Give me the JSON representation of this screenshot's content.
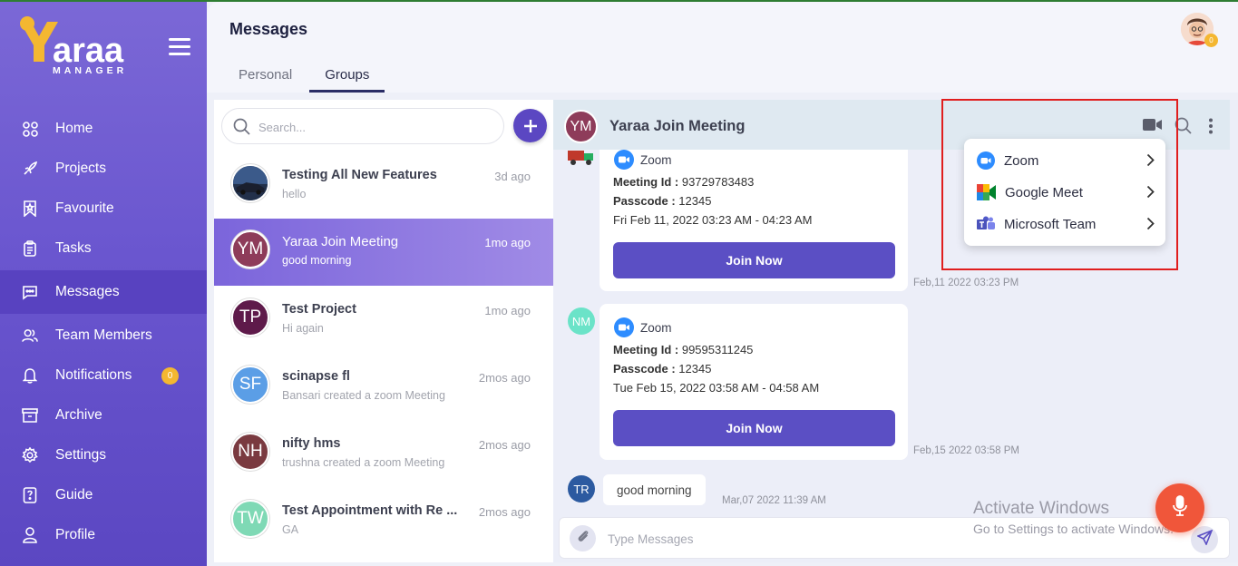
{
  "app": {
    "logo_text": "araa",
    "logo_sub": "MANAGER"
  },
  "sidebar": {
    "items": [
      {
        "label": "Home",
        "icon": "home-grid-icon"
      },
      {
        "label": "Projects",
        "icon": "rocket-icon"
      },
      {
        "label": "Favourite",
        "icon": "bookmark-icon"
      },
      {
        "label": "Tasks",
        "icon": "clipboard-icon"
      },
      {
        "label": "Messages",
        "icon": "chat-icon",
        "active": true
      },
      {
        "label": "Team Members",
        "icon": "users-icon"
      },
      {
        "label": "Notifications",
        "icon": "bell-icon",
        "badge": "0"
      },
      {
        "label": "Archive",
        "icon": "archive-icon"
      },
      {
        "label": "Settings",
        "icon": "gear-icon"
      },
      {
        "label": "Guide",
        "icon": "guide-icon"
      },
      {
        "label": "Profile",
        "icon": "user-icon"
      }
    ]
  },
  "header": {
    "title": "Messages",
    "avatar_badge": "0",
    "tabs": [
      {
        "label": "Personal"
      },
      {
        "label": "Groups",
        "active": true
      }
    ]
  },
  "search": {
    "placeholder": "Search..."
  },
  "conversations": [
    {
      "name": "Testing All New Features",
      "sub": "hello",
      "time": "3d ago",
      "avatar": "photo"
    },
    {
      "name": "Yaraa Join Meeting",
      "sub": "good morning",
      "time": "1mo ago",
      "initials": "YM",
      "color": "#8e3c5a",
      "active": true
    },
    {
      "name": "Test Project",
      "sub": "Hi again",
      "time": "1mo ago",
      "initials": "TP",
      "color": "#5e1a4a"
    },
    {
      "name": "scinapse fl",
      "sub": "Bansari created a zoom Meeting",
      "time": "2mos ago",
      "initials": "SF",
      "color": "#5b9ee6"
    },
    {
      "name": "nifty hms",
      "sub": "trushna created a zoom Meeting",
      "time": "2mos ago",
      "initials": "NH",
      "color": "#7a3a40"
    },
    {
      "name": "Test Appointment with Re ...",
      "sub": "GA",
      "time": "2mos ago",
      "initials": "TW",
      "color": "#7fd9b5"
    }
  ],
  "chat": {
    "title": "Yaraa Join Meeting",
    "initials": "YM",
    "messages": [
      {
        "platform": "Zoom",
        "meeting_id_label": "Meeting Id :",
        "meeting_id": "93729783483",
        "passcode_label": "Passcode :",
        "passcode": "12345",
        "when": "Fri Feb 11, 2022 03:23 AM - 04:23 AM",
        "button": "Join Now",
        "stamp": "Feb,11 2022 03:23 PM"
      },
      {
        "sender_initials": "NM",
        "platform": "Zoom",
        "meeting_id_label": "Meeting Id :",
        "meeting_id": "99595311245",
        "passcode_label": "Passcode :",
        "passcode": "12345",
        "when": "Tue Feb 15, 2022 03:58 AM - 04:58 AM",
        "button": "Join Now",
        "stamp": "Feb,15 2022 03:58 PM"
      },
      {
        "sender_initials": "TR",
        "text": "good morning",
        "stamp": "Mar,07 2022 11:39 AM"
      }
    ],
    "composer_placeholder": "Type Messages"
  },
  "video_menu": {
    "items": [
      {
        "label": "Zoom",
        "icon": "zoom-icon"
      },
      {
        "label": "Google Meet",
        "icon": "google-meet-icon"
      },
      {
        "label": "Microsoft Team",
        "icon": "microsoft-teams-icon"
      }
    ]
  },
  "watermark": {
    "line1": "Activate Windows",
    "line2": "Go to Settings to activate Windows."
  },
  "colors": {
    "sidebar": "#6a56cf",
    "accent": "#5b4fc4",
    "highlight": "#e01e1e",
    "mic": "#f0563a"
  }
}
